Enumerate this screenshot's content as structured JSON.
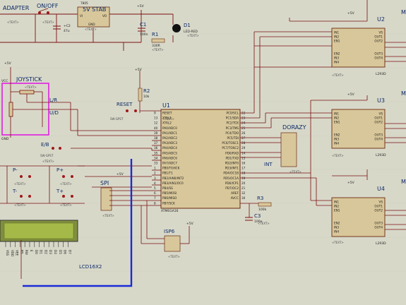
{
  "components": {
    "adapter": "ADAPTER",
    "onoff": "ON/OFF",
    "stab_title": "5V STAB",
    "stab_part": "7805",
    "stab_vi": "VI",
    "stab_vo": "VO",
    "stab_gnd": "GND",
    "vcc1": "+5V",
    "c2": "+C2",
    "c2_val": "47u",
    "c1": "C1",
    "c1_val": "100n",
    "r1": "R1",
    "r1_val": "330R",
    "d1": "D1",
    "d1_val": "LED-RED",
    "joystick": "JOYSTICK",
    "vcc": "VCC",
    "gnd": "GND",
    "lr": "L/R",
    "ud": "U/D",
    "reset": "RESET",
    "sw_gpst": "SW-GPST",
    "r2": "R2",
    "r2_val": "10k",
    "eb": "E/B",
    "p_minus": "P-",
    "p_plus": "P+",
    "t_minus": "T-",
    "t_plus": "T+",
    "u1": "U1",
    "mcu": "ATMEGA16",
    "spi": "SPI",
    "isp6": "ISP6",
    "lcd": "LCD16X2",
    "dorazy": "DORAZY",
    "int": "INT",
    "r3": "R3",
    "r3_val": "100k",
    "c3": "C3",
    "c3_val": "100n",
    "u2": "U2",
    "u3": "U3",
    "u4": "U4",
    "l293": "L293D",
    "mo": "MO",
    "plus5v": "+5V",
    "text_tag": "<TEXT>"
  },
  "mcu_left_pins": [
    "RESET",
    "XTAL1",
    "XTAL2",
    "PA0/ADC0",
    "PA1/ADC1",
    "PA2/ADC2",
    "PA3/ADC3",
    "PA4/ADC4",
    "PA5/ADC5",
    "PA6/ADC6",
    "PA7/ADC7",
    "PB0/T0/XCK",
    "PB1/T1",
    "PB2/AIN0/INT2",
    "PB3/AIN1/OC0",
    "PB4/SS",
    "PB5/MOSI",
    "PB6/MISO",
    "PB7/SCK"
  ],
  "mcu_right_pins": [
    "PC0/SCL",
    "PC1/SDA",
    "PC2/TCK",
    "PC3/TMS",
    "PC4/TDO",
    "PC5/TDI",
    "PC6/TOSC1",
    "PC7/TOSC2",
    "PD0/RXD",
    "PD1/TXD",
    "PD2/INT0",
    "PD3/INT1",
    "PD4/OC1B",
    "PD5/OC1A",
    "PD6/ICP1",
    "PD7/OC2",
    "AREF",
    "AVCC"
  ],
  "mcu_left_nums": [
    "9",
    "13",
    "12",
    "40",
    "39",
    "38",
    "37",
    "36",
    "35",
    "34",
    "33",
    "1",
    "2",
    "3",
    "4",
    "5",
    "6",
    "7",
    "8"
  ],
  "mcu_right_nums": [
    "22",
    "23",
    "24",
    "25",
    "26",
    "27",
    "28",
    "29",
    "14",
    "15",
    "16",
    "17",
    "18",
    "19",
    "20",
    "21",
    "32",
    "30"
  ],
  "driver_left_pins": [
    "IN1",
    "IN2",
    "EN1",
    "EN2",
    "IN3",
    "IN4"
  ],
  "driver_right_pins": [
    "VS",
    "OUT1",
    "OUT2",
    "OUT3",
    "OUT4"
  ],
  "lcd_pins": [
    "VSS",
    "VDD",
    "VEE",
    "RS",
    "RW",
    "E",
    "D0",
    "D1",
    "D2",
    "D3",
    "D4",
    "D5",
    "D6",
    "D7"
  ]
}
